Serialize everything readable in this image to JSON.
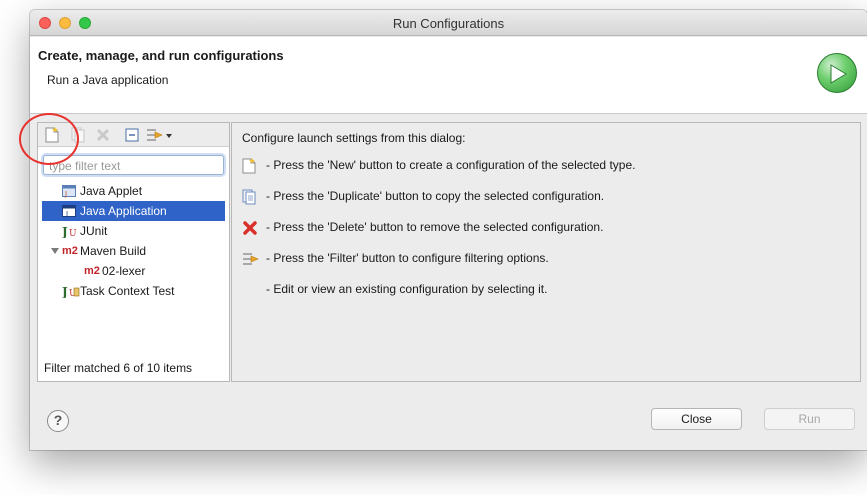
{
  "window": {
    "title": "Run Configurations"
  },
  "header": {
    "title": "Create, manage, and run configurations",
    "subtitle": "Run a Java application"
  },
  "left_panel": {
    "toolbar_icons": [
      "new-config-icon",
      "duplicate-icon",
      "delete-icon",
      "collapse-all-icon",
      "filter-icon",
      "dropdown-arrow-icon"
    ],
    "filter_placeholder": "type filter text",
    "tree": [
      {
        "label": "Java Applet",
        "icon": "java-applet-icon",
        "selected": false,
        "level": 0
      },
      {
        "label": "Java Application",
        "icon": "java-application-icon",
        "selected": true,
        "level": 0
      },
      {
        "label": "JUnit",
        "icon": "junit-icon",
        "selected": false,
        "level": 0
      },
      {
        "label": "Maven Build",
        "icon": "maven-icon",
        "selected": false,
        "level": 0,
        "expanded": true,
        "badge": "m2"
      },
      {
        "label": "02-lexer",
        "icon": "maven-icon",
        "selected": false,
        "level": 1,
        "badge": "m2"
      },
      {
        "label": "Task Context Test",
        "icon": "task-context-test-icon",
        "selected": false,
        "level": 0
      }
    ],
    "filter_status": "Filter matched 6 of 10 items"
  },
  "right_panel": {
    "intro": "Configure launch settings from this dialog:",
    "lines": [
      {
        "icon": "new-config-icon",
        "text": "- Press the 'New' button to create a configuration of the selected type."
      },
      {
        "icon": "duplicate-icon",
        "text": "- Press the 'Duplicate' button to copy the selected configuration."
      },
      {
        "icon": "delete-icon",
        "text": "- Press the 'Delete' button to remove the selected configuration."
      },
      {
        "icon": "filter-icon",
        "text": "- Press the 'Filter' button to configure filtering options."
      },
      {
        "icon": "",
        "text": "- Edit or view an existing configuration by selecting it."
      }
    ]
  },
  "footer": {
    "help_label": "?",
    "close_label": "Close",
    "run_label": "Run"
  },
  "colors": {
    "selection": "#2f63c7",
    "annotation_circle": "#e8322e",
    "run_green": "#3fae45"
  }
}
